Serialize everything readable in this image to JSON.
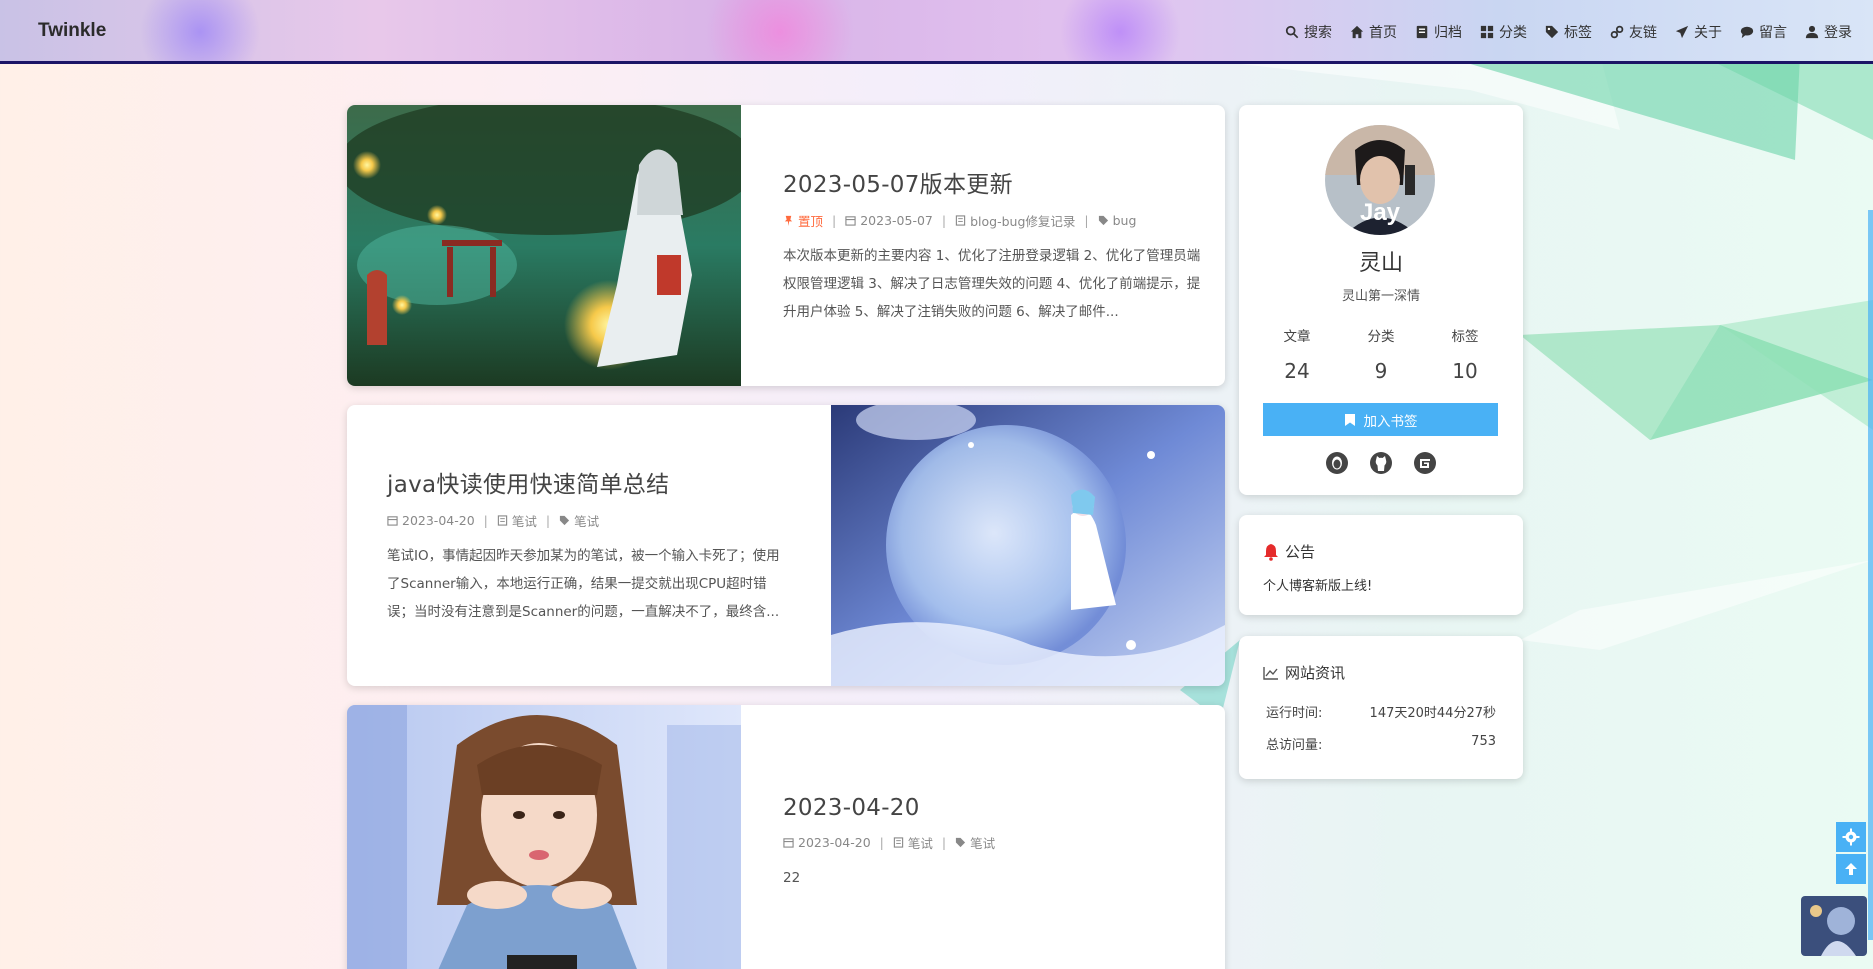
{
  "brand": "Twinkle",
  "nav": {
    "items": [
      {
        "label": "搜索",
        "icon": "search-icon"
      },
      {
        "label": "首页",
        "icon": "home-icon"
      },
      {
        "label": "归档",
        "icon": "archive-icon"
      },
      {
        "label": "分类",
        "icon": "category-icon"
      },
      {
        "label": "标签",
        "icon": "tag-icon"
      },
      {
        "label": "友链",
        "icon": "link-icon"
      },
      {
        "label": "关于",
        "icon": "paper-plane-icon"
      },
      {
        "label": "留言",
        "icon": "comment-icon"
      },
      {
        "label": "登录",
        "icon": "user-icon"
      }
    ]
  },
  "posts": [
    {
      "title": "2023-05-07版本更新",
      "pinned": "置顶",
      "date": "2023-05-07",
      "category": "blog-bug修复记录",
      "tag": "bug",
      "excerpt": "本次版本更新的主要内容 1、优化了注册登录逻辑 2、优化了管理员端权限管理逻辑 3、解决了日志管理失效的问题 4、优化了前端提示，提升用户体验 5、解决了注销失败的问题 6、解决了邮件..."
    },
    {
      "title": "java快读使用快速简单总结",
      "date": "2023-04-20",
      "category": "笔试",
      "tag": "笔试",
      "excerpt": "笔试IO，事情起因昨天参加某为的笔试，被一个输入卡死了；使用了Scanner输入，本地运行正确，结果一提交就出现CPU超时错误；当时没有注意到是Scanner的问题，一直解决不了，最终含..."
    },
    {
      "title": "2023-04-20",
      "date": "2023-04-20",
      "category": "笔试",
      "tag": "笔试",
      "excerpt": "22"
    }
  ],
  "profile": {
    "name": "灵山",
    "motto": "灵山第一深情",
    "avatar_text": "Jay",
    "stats": [
      {
        "label": "文章",
        "value": "24"
      },
      {
        "label": "分类",
        "value": "9"
      },
      {
        "label": "标签",
        "value": "10"
      }
    ],
    "bookmark_label": "加入书签",
    "socials": [
      "qq-icon",
      "github-icon",
      "gitee-icon"
    ]
  },
  "notice": {
    "title": "公告",
    "text": "个人博客新版上线!"
  },
  "site_info": {
    "title": "网站资讯",
    "rows": [
      {
        "label": "运行时间:",
        "value": "147天20时44分27秒"
      },
      {
        "label": "总访问量:",
        "value": "753"
      }
    ]
  },
  "colors": {
    "accent": "#49b1f5",
    "pin": "#ff6a3d",
    "notice_bell": "#e52b2b"
  }
}
